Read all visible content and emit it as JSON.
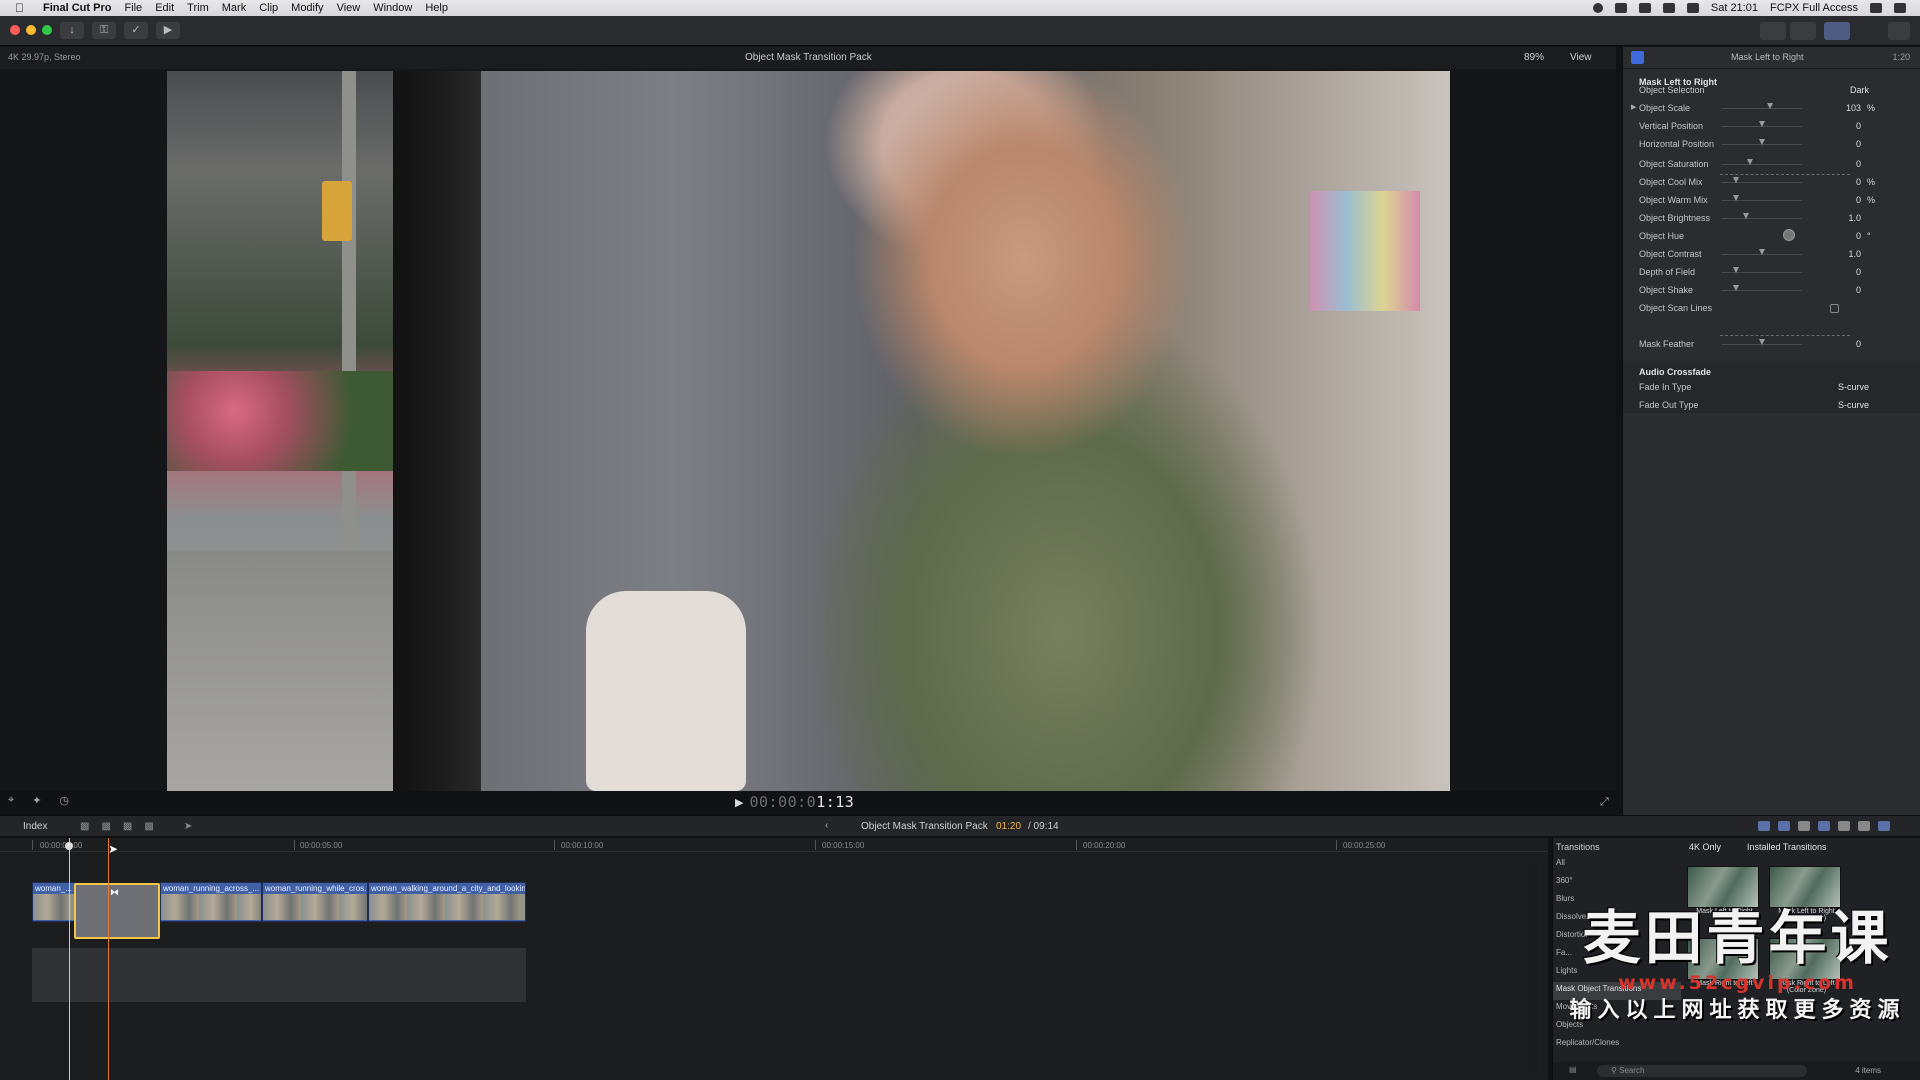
{
  "menubar": {
    "apple": "",
    "app_name": "Final Cut Pro",
    "items": [
      "File",
      "Edit",
      "Trim",
      "Mark",
      "Clip",
      "Modify",
      "View",
      "Window",
      "Help"
    ],
    "clock": "Sat 21:01",
    "user": "FCPX Full Access"
  },
  "viewer": {
    "format": "4K 29.97p, Stereo",
    "title": "Object Mask Transition Pack",
    "zoom": "89%",
    "view_menu": "View",
    "timecode_dim": "00:00:0",
    "timecode": "1:13"
  },
  "inspector": {
    "header_title": "Mask Left to Right",
    "header_duration": "1:20",
    "section_title": "Mask Left to Right",
    "params": [
      {
        "label": "Object Selection",
        "type": "popup",
        "value": "Dark"
      },
      {
        "label": "Object Scale",
        "type": "slider",
        "value": "103",
        "unit": "%",
        "level": 0.6,
        "expandable": true
      },
      {
        "label": "Vertical Position",
        "type": "slider",
        "value": "0",
        "unit": "",
        "level": 0.5
      },
      {
        "label": "Horizontal Position",
        "type": "slider",
        "value": "0",
        "unit": "",
        "level": 0.5
      },
      {
        "label": "Object Saturation",
        "type": "slider",
        "value": "0",
        "unit": "",
        "level": 0.35
      },
      {
        "label": "Object Cool Mix",
        "type": "slider",
        "value": "0",
        "unit": "%",
        "level": 0.18
      },
      {
        "label": "Object Warm Mix",
        "type": "slider",
        "value": "0",
        "unit": "%",
        "level": 0.18
      },
      {
        "label": "Object Brightness",
        "type": "slider",
        "value": "1.0",
        "unit": "",
        "level": 0.3
      },
      {
        "label": "Object Hue",
        "type": "dial",
        "value": "0",
        "unit": "°"
      },
      {
        "label": "Object Contrast",
        "type": "slider",
        "value": "1.0",
        "unit": "",
        "level": 0.5
      },
      {
        "label": "Depth of Field",
        "type": "slider",
        "value": "0",
        "unit": "",
        "level": 0.18
      },
      {
        "label": "Object Shake",
        "type": "slider",
        "value": "0",
        "unit": "",
        "level": 0.18
      },
      {
        "label": "Object Scan Lines",
        "type": "checkbox",
        "value": ""
      },
      {
        "label": "Mask Feather",
        "type": "slider",
        "value": "0",
        "unit": "",
        "level": 0.5
      }
    ],
    "audio_section": "Audio Crossfade",
    "fade_in_label": "Fade In Type",
    "fade_in_value": "S-curve",
    "fade_out_label": "Fade Out Type",
    "fade_out_value": "S-curve"
  },
  "timeline_header": {
    "index": "Index",
    "project": "Object Mask Transition Pack",
    "position": "01:20",
    "duration": "/ 09:14"
  },
  "ruler": [
    "00:00:00:00",
    "00:00:05:00",
    "00:00:10:00",
    "00:00:15:00",
    "00:00:20:00",
    "00:00:25:00"
  ],
  "clips": [
    {
      "name": "woman_..."
    },
    {
      "name": "woman_running_across_..."
    },
    {
      "name": "woman_running_while_cros..."
    },
    {
      "name": "woman_walking_around_a_city_and_lookin..."
    }
  ],
  "transition_marker": "⧓",
  "browser": {
    "title": "Transitions",
    "filter": "4K Only",
    "source": "Installed Transitions",
    "categories": [
      "All",
      "360°",
      "Blurs",
      "Dissolves",
      "Distortion Warps",
      "Fa...",
      "Lights",
      "Mask Object Transitions",
      "Movements",
      "Objects",
      "Replicator/Clones"
    ],
    "selected_category": "Mask Object Transitions",
    "items": [
      "Mask Left to Right",
      "Mask Left to Right (Color Zone)",
      "Mask Right to Left",
      "Mask Right to Left (Color Zone)"
    ],
    "search_placeholder": "Search",
    "count": "4 items"
  },
  "watermark": {
    "title": "麦田青年课",
    "url": "www.52cgvip.com",
    "subtitle": "输入以上网址获取更多资源"
  }
}
